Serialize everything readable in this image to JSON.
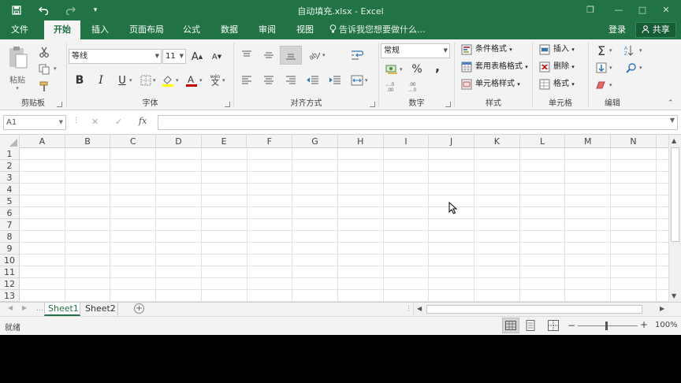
{
  "window": {
    "title": "自动填充.xlsx - Excel",
    "restore_symbol": "❐",
    "minimize_symbol": "—",
    "maximize_symbol": "□",
    "close_symbol": "✕"
  },
  "tabs": [
    {
      "label": "文件"
    },
    {
      "label": "开始",
      "active": true
    },
    {
      "label": "插入"
    },
    {
      "label": "页面布局"
    },
    {
      "label": "公式"
    },
    {
      "label": "数据"
    },
    {
      "label": "审阅"
    },
    {
      "label": "视图"
    }
  ],
  "tell_me": "告诉我您想要做什么...",
  "login": "登录",
  "share": "共享",
  "ribbon": {
    "clipboard": {
      "label": "剪贴板",
      "paste": "粘贴"
    },
    "font": {
      "label": "字体",
      "name": "等线",
      "size": "11",
      "bold": "B",
      "italic": "I",
      "underline": "U",
      "grow": "A",
      "shrink": "A",
      "phonetic": "文"
    },
    "alignment": {
      "label": "对齐方式"
    },
    "number": {
      "label": "数字",
      "format": "常规",
      "percent": "%",
      "comma": ",",
      "inc_decimal": "+.0\n.00",
      "dec_decimal": ".00\n→.0"
    },
    "styles": {
      "label": "样式",
      "conditional": "条件格式",
      "table": "套用表格格式",
      "cell_styles": "单元格样式"
    },
    "cells": {
      "label": "单元格",
      "insert": "插入",
      "delete": "删除",
      "format": "格式"
    },
    "editing": {
      "label": "编辑"
    }
  },
  "formula_bar": {
    "name_box": "A1",
    "cancel": "✕",
    "enter": "✓",
    "fx": "fx",
    "formula": ""
  },
  "columns": [
    "A",
    "B",
    "C",
    "D",
    "E",
    "F",
    "G",
    "H",
    "I",
    "J",
    "K",
    "L",
    "M",
    "N"
  ],
  "rows": [
    "1",
    "2",
    "3",
    "4",
    "5",
    "6",
    "7",
    "8",
    "9",
    "10",
    "11",
    "12",
    "13"
  ],
  "sheets": [
    {
      "label": "Sheet1",
      "active": true
    },
    {
      "label": "Sheet2",
      "active": false
    }
  ],
  "add_sheet": "+",
  "status": {
    "ready": "就绪",
    "zoom": "100%",
    "zoom_minus": "−",
    "zoom_plus": "+"
  },
  "colors": {
    "accent": "#217346",
    "font_color": "#c00000",
    "highlight": "#ffff00"
  }
}
